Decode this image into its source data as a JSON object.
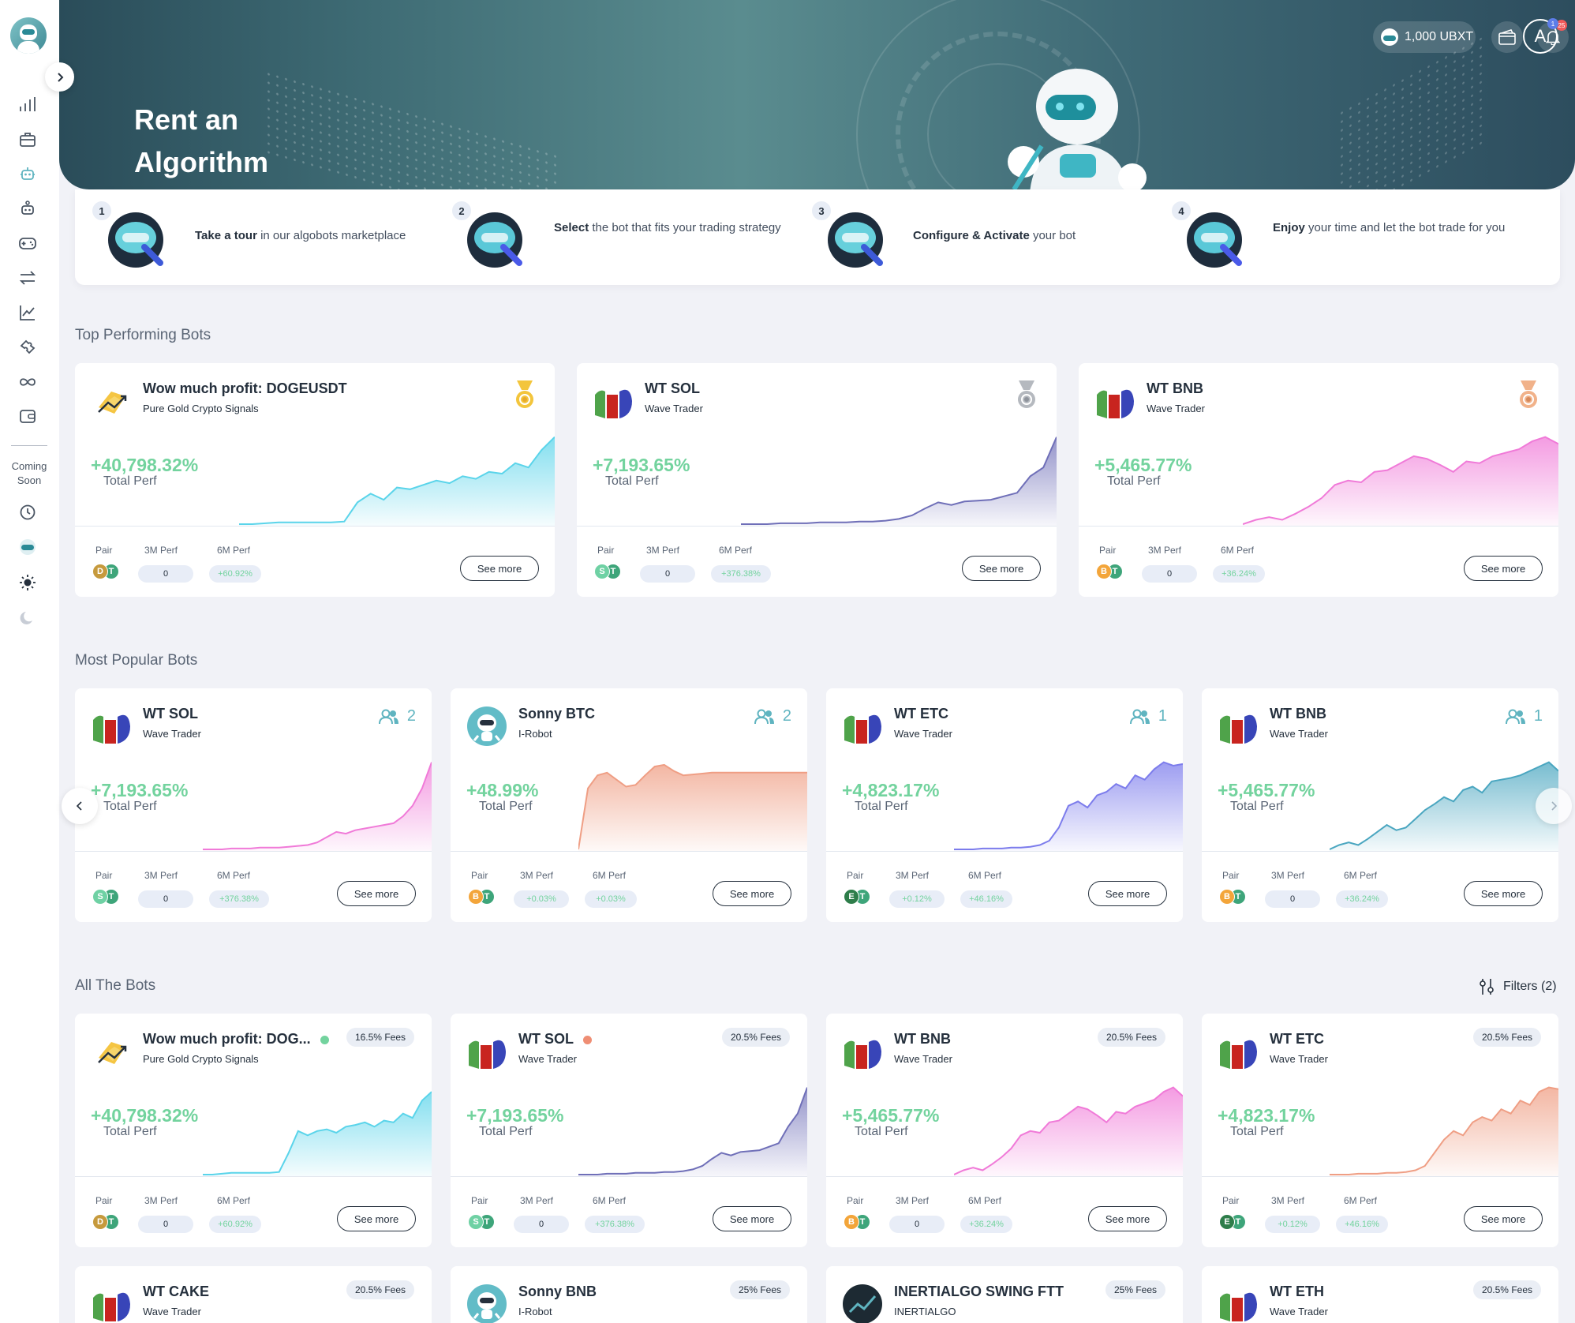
{
  "header": {
    "title_line1": "Rent an",
    "title_line2": "Algorithm",
    "balance": "1,000 UBXT",
    "notifications_count": "25",
    "avatar_letter": "A",
    "avatar_badge": "1"
  },
  "sidebar": {
    "coming_soon_line1": "Coming",
    "coming_soon_line2": "Soon",
    "icons": [
      "chart-bars-icon",
      "briefcase-icon",
      "robot-icon",
      "bot-settings-icon",
      "gamepad-icon",
      "swap-arrows-icon",
      "line-chart-icon",
      "puzzle-icon",
      "infinity-icon",
      "wallet-icon"
    ],
    "coming_icons": [
      "clock-icon",
      "ubxt-icon",
      "sun-icon",
      "moon-icon"
    ]
  },
  "steps": [
    {
      "num": "1",
      "bold": "Take a tour",
      "rest": "in our algobots marketplace"
    },
    {
      "num": "2",
      "bold": "Select",
      "rest": "the bot that fits your trading strategy"
    },
    {
      "num": "3",
      "bold": "Configure & Activate",
      "rest": "your bot"
    },
    {
      "num": "4",
      "bold": "Enjoy",
      "rest": "your time and let the bot trade for you"
    }
  ],
  "labels": {
    "total_perf": "Total Perf",
    "pair": "Pair",
    "perf_3m": "3M Perf",
    "perf_6m": "6M Perf",
    "see_more": "See more"
  },
  "sections": {
    "top": "Top Performing Bots",
    "popular": "Most Popular Bots",
    "all": "All The Bots",
    "filters": "Filters (2)"
  },
  "top_bots": [
    {
      "name": "Wow much profit: DOGEUSDT",
      "sub": "Pure Gold Crypto Signals",
      "perf": "+40,798.32%",
      "p3m": "0",
      "p6m": "+60.92%",
      "medal": "gold",
      "icon": "gold-signals",
      "pair": [
        "D",
        "T"
      ],
      "color": "#5ad4ea",
      "curve": [
        0,
        0,
        0.01,
        0.02,
        0.02,
        0.02,
        0.02,
        0.02,
        0.03,
        0.25,
        0.35,
        0.28,
        0.42,
        0.4,
        0.45,
        0.5,
        0.47,
        0.55,
        0.52,
        0.6,
        0.58,
        0.7,
        0.65,
        0.85,
        1
      ]
    },
    {
      "name": "WT SOL",
      "sub": "Wave Trader",
      "perf": "+7,193.65%",
      "p3m": "0",
      "p6m": "+376.38%",
      "medal": "silver",
      "icon": "wave",
      "pair": [
        "S",
        "T"
      ],
      "color": "#6f6fb8",
      "curve": [
        0,
        0,
        0,
        0.01,
        0.01,
        0.01,
        0.02,
        0.02,
        0.02,
        0.03,
        0.03,
        0.04,
        0.06,
        0.1,
        0.18,
        0.25,
        0.22,
        0.26,
        0.27,
        0.28,
        0.32,
        0.36,
        0.55,
        0.65,
        1
      ]
    },
    {
      "name": "WT BNB",
      "sub": "Wave Trader",
      "perf": "+5,465.77%",
      "p3m": "0",
      "p6m": "+36.24%",
      "medal": "bronze",
      "icon": "wave",
      "pair": [
        "B",
        "T"
      ],
      "color": "#f07ad8",
      "curve": [
        0,
        0.05,
        0.08,
        0.05,
        0.12,
        0.2,
        0.3,
        0.45,
        0.5,
        0.48,
        0.6,
        0.62,
        0.7,
        0.78,
        0.75,
        0.68,
        0.6,
        0.72,
        0.7,
        0.78,
        0.82,
        0.86,
        0.95,
        1,
        0.92
      ]
    }
  ],
  "popular_bots": [
    {
      "name": "WT SOL",
      "sub": "Wave Trader",
      "perf": "+7,193.65%",
      "p3m": "0",
      "p6m": "+376.38%",
      "users": "2",
      "icon": "wave",
      "pair": [
        "S",
        "T"
      ],
      "color": "#f07ad8",
      "curve": [
        0,
        0,
        0,
        0.01,
        0.01,
        0.01,
        0.02,
        0.02,
        0.02,
        0.03,
        0.04,
        0.05,
        0.08,
        0.14,
        0.2,
        0.18,
        0.22,
        0.24,
        0.26,
        0.28,
        0.3,
        0.38,
        0.5,
        0.7,
        1
      ]
    },
    {
      "name": "Sonny BTC",
      "sub": "I-Robot",
      "perf": "+48.99%",
      "p3m": "+0.03%",
      "p6m": "+0.03%",
      "users": "2",
      "icon": "robot",
      "pair": [
        "B",
        "T"
      ],
      "color": "#ef9e84",
      "curve": [
        0,
        0.7,
        0.85,
        0.88,
        0.8,
        0.72,
        0.74,
        0.85,
        0.95,
        0.97,
        0.9,
        0.85,
        0.86,
        0.87,
        0.88,
        0.88,
        0.88,
        0.88,
        0.88,
        0.88,
        0.88,
        0.88,
        0.88,
        0.88,
        0.88
      ]
    },
    {
      "name": "WT ETC",
      "sub": "Wave Trader",
      "perf": "+4,823.17%",
      "p3m": "+0.12%",
      "p6m": "+46.16%",
      "users": "1",
      "icon": "wave",
      "pair": [
        "E",
        "T"
      ],
      "color": "#7c7cec",
      "curve": [
        0,
        0,
        0,
        0.01,
        0.01,
        0.01,
        0.02,
        0.02,
        0.03,
        0.05,
        0.1,
        0.25,
        0.5,
        0.55,
        0.48,
        0.62,
        0.66,
        0.75,
        0.7,
        0.85,
        0.8,
        0.92,
        1,
        0.96,
        0.98
      ]
    },
    {
      "name": "WT BNB",
      "sub": "Wave Trader",
      "perf": "+5,465.77%",
      "p3m": "0",
      "p6m": "+36.24%",
      "users": "1",
      "icon": "wave",
      "pair": [
        "B",
        "T"
      ],
      "color": "#4aa6c0",
      "curve": [
        0,
        0.05,
        0.08,
        0.05,
        0.12,
        0.2,
        0.28,
        0.22,
        0.25,
        0.35,
        0.45,
        0.52,
        0.6,
        0.55,
        0.68,
        0.72,
        0.65,
        0.78,
        0.8,
        0.82,
        0.85,
        0.9,
        0.95,
        1,
        0.9
      ]
    }
  ],
  "all_bots": [
    {
      "name": "Wow much profit: DOG...",
      "sub": "Pure Gold Crypto Signals",
      "perf": "+40,798.32%",
      "p3m": "0",
      "p6m": "+60.92%",
      "fees": "16.5% Fees",
      "dot": "#73d39e",
      "icon": "gold-signals",
      "pair": [
        "D",
        "T"
      ],
      "color": "#5ad4ea",
      "curve": [
        0,
        0,
        0.01,
        0.02,
        0.02,
        0.02,
        0.02,
        0.02,
        0.03,
        0.25,
        0.5,
        0.45,
        0.5,
        0.52,
        0.48,
        0.55,
        0.57,
        0.6,
        0.55,
        0.62,
        0.6,
        0.7,
        0.65,
        0.85,
        0.95
      ]
    },
    {
      "name": "WT SOL",
      "sub": "Wave Trader",
      "perf": "+7,193.65%",
      "p3m": "0",
      "p6m": "+376.38%",
      "fees": "20.5% Fees",
      "dot": "#ef8e74",
      "icon": "wave",
      "pair": [
        "S",
        "T"
      ],
      "color": "#6f6fb8",
      "curve": [
        0,
        0,
        0,
        0.01,
        0.01,
        0.01,
        0.02,
        0.02,
        0.02,
        0.03,
        0.03,
        0.04,
        0.06,
        0.1,
        0.18,
        0.25,
        0.22,
        0.26,
        0.27,
        0.28,
        0.32,
        0.36,
        0.55,
        0.7,
        1
      ]
    },
    {
      "name": "WT BNB",
      "sub": "Wave Trader",
      "perf": "+5,465.77%",
      "p3m": "0",
      "p6m": "+36.24%",
      "fees": "20.5% Fees",
      "dot": "",
      "icon": "wave",
      "pair": [
        "B",
        "T"
      ],
      "color": "#f07ad8",
      "curve": [
        0,
        0.05,
        0.08,
        0.05,
        0.12,
        0.2,
        0.3,
        0.45,
        0.5,
        0.48,
        0.6,
        0.62,
        0.7,
        0.78,
        0.75,
        0.68,
        0.6,
        0.72,
        0.7,
        0.78,
        0.82,
        0.86,
        0.95,
        1,
        0.9
      ]
    },
    {
      "name": "WT ETC",
      "sub": "Wave Trader",
      "perf": "+4,823.17%",
      "p3m": "+0.12%",
      "p6m": "+46.16%",
      "fees": "20.5% Fees",
      "dot": "",
      "icon": "wave",
      "pair": [
        "E",
        "T"
      ],
      "color": "#ef9e84",
      "curve": [
        0,
        0,
        0,
        0.01,
        0.01,
        0.01,
        0.02,
        0.02,
        0.03,
        0.05,
        0.1,
        0.25,
        0.4,
        0.5,
        0.45,
        0.6,
        0.66,
        0.62,
        0.75,
        0.7,
        0.85,
        0.8,
        0.95,
        1,
        0.98
      ]
    }
  ],
  "bottom_bots": [
    {
      "name": "WT CAKE",
      "sub": "Wave Trader",
      "fees": "20.5% Fees",
      "icon": "wave"
    },
    {
      "name": "Sonny BNB",
      "sub": "I-Robot",
      "fees": "25% Fees",
      "icon": "robot"
    },
    {
      "name": "INERTIALGO SWING FTT",
      "sub": "INERTIALGO",
      "fees": "25% Fees",
      "icon": "inertialgo"
    },
    {
      "name": "WT ETH",
      "sub": "Wave Trader",
      "fees": "20.5% Fees",
      "icon": "wave"
    }
  ]
}
